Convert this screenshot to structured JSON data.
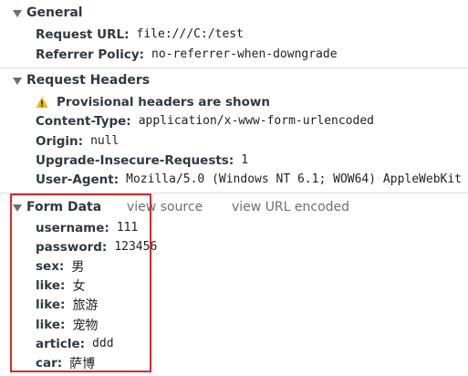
{
  "general": {
    "title": "General",
    "request_url_key": "Request URL:",
    "request_url_value": "file:///C:/test",
    "referrer_policy_key": "Referrer Policy:",
    "referrer_policy_value": "no-referrer-when-downgrade"
  },
  "request_headers": {
    "title": "Request Headers",
    "warning": "Provisional headers are shown",
    "content_type_key": "Content-Type:",
    "content_type_value": "application/x-www-form-urlencoded",
    "origin_key": "Origin:",
    "origin_value": "null",
    "upgrade_key": "Upgrade-Insecure-Requests:",
    "upgrade_value": "1",
    "user_agent_key": "User-Agent:",
    "user_agent_value": "Mozilla/5.0 (Windows NT 6.1; WOW64) AppleWebKit"
  },
  "form_data": {
    "title": "Form Data",
    "view_source": "view source",
    "view_url_encoded": "view URL encoded",
    "fields": [
      {
        "key": "username:",
        "value": "111"
      },
      {
        "key": "password:",
        "value": "123456"
      },
      {
        "key": "sex:",
        "value": "男"
      },
      {
        "key": "like:",
        "value": "女"
      },
      {
        "key": "like:",
        "value": "旅游"
      },
      {
        "key": "like:",
        "value": "宠物"
      },
      {
        "key": "article:",
        "value": "ddd"
      },
      {
        "key": "car:",
        "value": "萨博"
      }
    ]
  },
  "colors": {
    "highlight_border": "#e0262a",
    "warning_icon": "#f4b400",
    "link_gray": "#6f6f6f"
  }
}
